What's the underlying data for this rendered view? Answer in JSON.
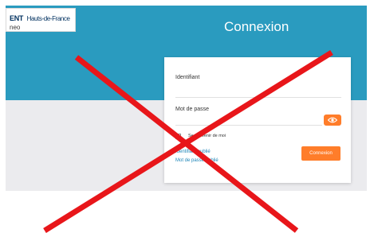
{
  "logo": {
    "ent": "ENT",
    "region": "Hauts-de-France",
    "product": "neo"
  },
  "page": {
    "title": "Connexion"
  },
  "form": {
    "identifiant_label": "Identifiant",
    "identifiant_value": "",
    "password_label": "Mot de passe",
    "password_value": "",
    "show_password_icon": "eye-icon",
    "remember_label": "Se souvenir de moi",
    "remember_checked": false,
    "forgot_login": "Identifiant oublié",
    "forgot_password": "Mot de passe oublié",
    "submit_label": "Connexion"
  },
  "overlay": {
    "mark": "red-cross",
    "color": "#e8161a"
  },
  "colors": {
    "header": "#2a9bbf",
    "accent": "#ff7d2a",
    "link": "#1f86b8"
  }
}
